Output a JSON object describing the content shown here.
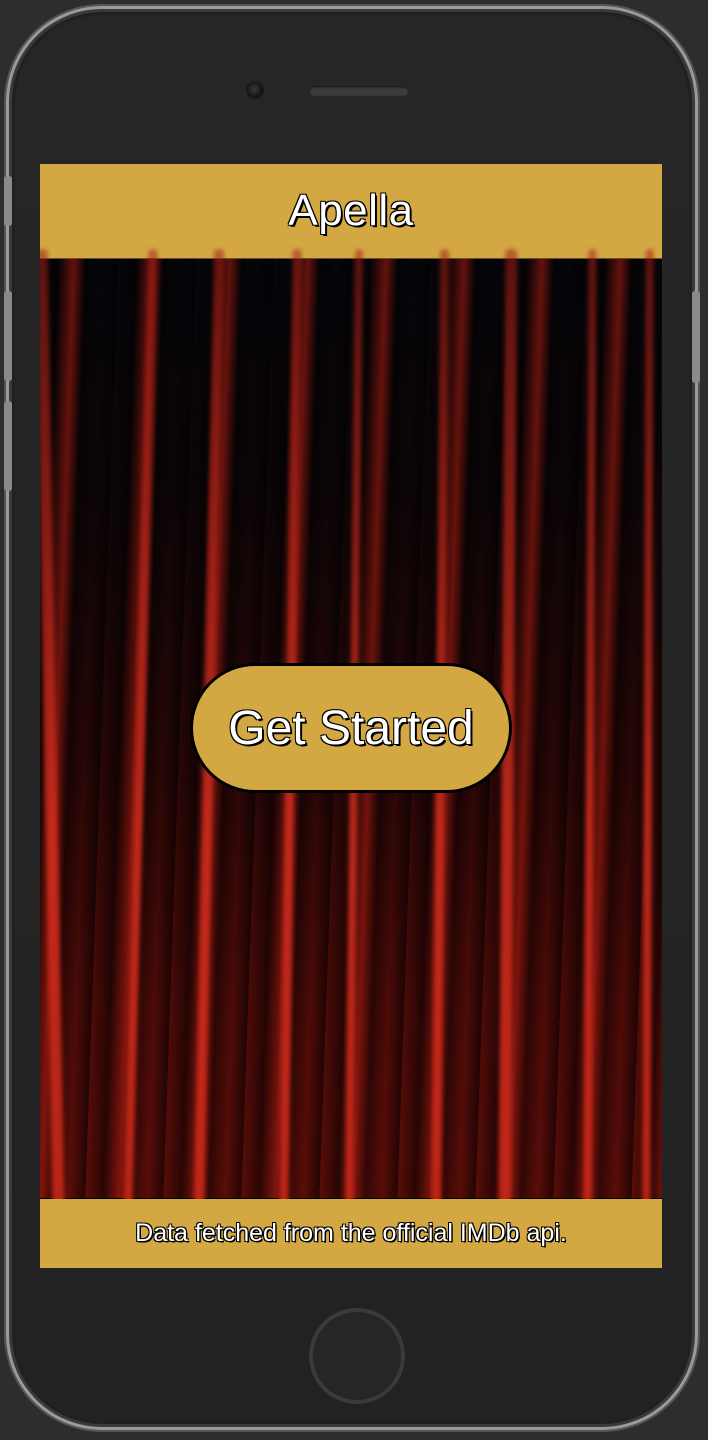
{
  "app": {
    "title": "Apella"
  },
  "hero": {
    "button_label": "Get Started",
    "background": "red-theater-curtain"
  },
  "footer": {
    "text": "Data fetched from the official IMDb api."
  },
  "colors": {
    "accent": "#d3a843",
    "text": "#ffffff",
    "curtain": "#5a0d09"
  }
}
